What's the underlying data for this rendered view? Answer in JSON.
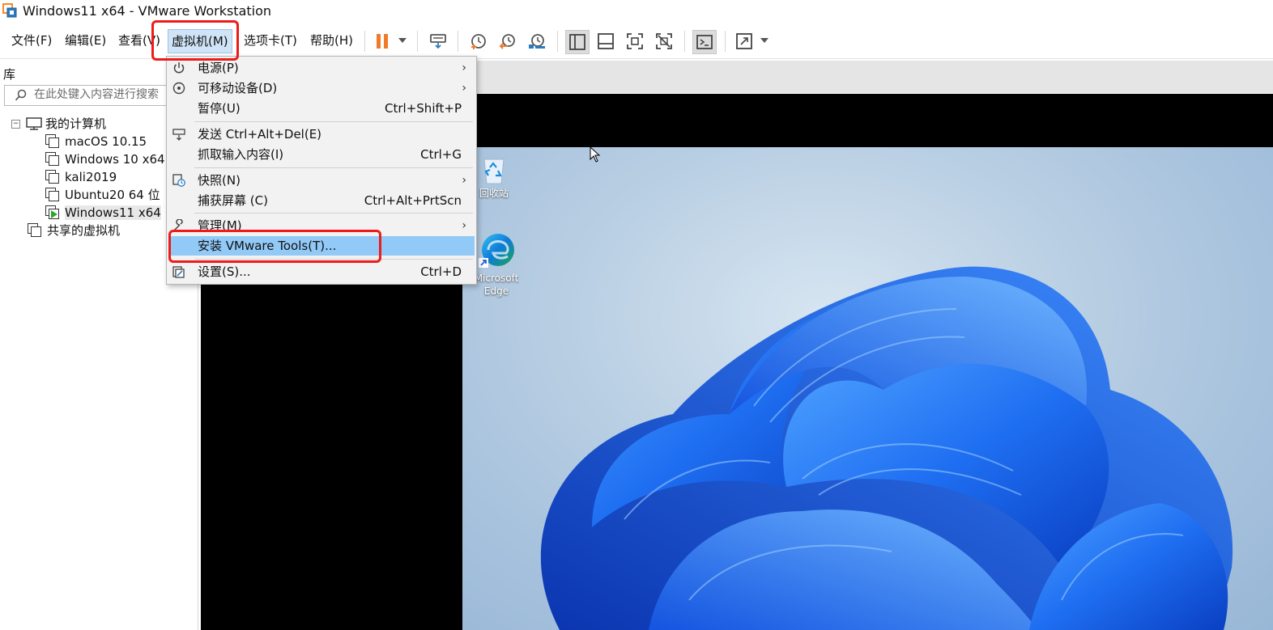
{
  "window": {
    "title": "Windows11 x64 - VMware Workstation",
    "app_icon": "vmware-app-icon"
  },
  "menubar": {
    "items": [
      {
        "label": "文件(F)"
      },
      {
        "label": "编辑(E)"
      },
      {
        "label": "查看(V)"
      },
      {
        "label": "虚拟机(M)",
        "active": true
      },
      {
        "label": "选项卡(T)"
      },
      {
        "label": "帮助(H)"
      }
    ]
  },
  "toolbar": {
    "icons": [
      "pause-icon",
      "dropdown-caret-icon",
      "send-ctrl-alt-del-icon",
      "take-snapshot-icon",
      "revert-snapshot-icon",
      "snapshot-manager-icon",
      "show-library-icon",
      "show-thumbnail-bar-icon",
      "full-screen-icon",
      "unity-icon",
      "console-view-icon",
      "stretch-guest-icon"
    ],
    "accent_color": "#f07a2a"
  },
  "library": {
    "title": "库",
    "search_placeholder": "在此处键入内容进行搜索",
    "tree": {
      "root": "我的计算机",
      "vms": [
        {
          "label": "macOS 10.15"
        },
        {
          "label": "Windows 10 x64"
        },
        {
          "label": "kali2019"
        },
        {
          "label": "Ubuntu20 64 位"
        },
        {
          "label": "Windows11 x64",
          "running": true,
          "selected": true
        }
      ],
      "shared": "共享的虚拟机"
    }
  },
  "vm_menu": {
    "items": [
      {
        "label": "电源(P)",
        "submenu": true,
        "icon": "power-icon"
      },
      {
        "label": "可移动设备(D)",
        "submenu": true,
        "icon": "removable-devices-icon"
      },
      {
        "label": "暂停(U)",
        "shortcut": "Ctrl+Shift+P"
      },
      {
        "label": "发送 Ctrl+Alt+Del(E)",
        "icon": "send-keys-icon"
      },
      {
        "label": "抓取输入内容(I)",
        "shortcut": "Ctrl+G"
      },
      {
        "label": "快照(N)",
        "submenu": true,
        "icon": "snapshot-icon"
      },
      {
        "label": "捕获屏幕 (C)",
        "shortcut": "Ctrl+Alt+PrtScn"
      },
      {
        "label": "管理(M)",
        "submenu": true,
        "icon": "wrench-icon"
      },
      {
        "label": "安装 VMware Tools(T)...",
        "highlighted": true
      },
      {
        "label": "设置(S)...",
        "shortcut": "Ctrl+D",
        "icon": "settings-icon"
      }
    ],
    "highlight_color": "#91c9f7"
  },
  "guest_desktop": {
    "icons": [
      {
        "label": "回收站",
        "icon": "recycle-bin-icon"
      },
      {
        "label": "Microsoft Edge",
        "icon": "edge-icon"
      }
    ],
    "wallpaper_color": "#1f6ff2"
  },
  "annotations": {
    "color": "#ee1b1b"
  }
}
